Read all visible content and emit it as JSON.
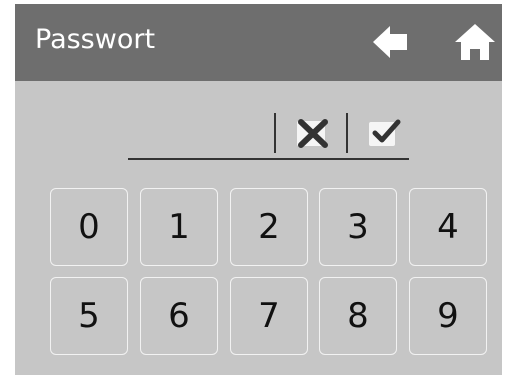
{
  "header": {
    "title": "Passwort",
    "back_icon": "arrow-left-icon",
    "home_icon": "home-icon"
  },
  "entry": {
    "value": "",
    "clear_icon": "clear-x-icon",
    "confirm_icon": "checkmark-icon"
  },
  "keypad": {
    "keys": [
      "0",
      "1",
      "2",
      "3",
      "4",
      "5",
      "6",
      "7",
      "8",
      "9"
    ]
  },
  "colors": {
    "header_bg": "#6e6e6e",
    "panel_bg": "#c6c6c6",
    "text": "#111111",
    "key_border": "#f2f2f2",
    "icon_light": "#f5f5f5",
    "icon_dark": "#333333"
  }
}
